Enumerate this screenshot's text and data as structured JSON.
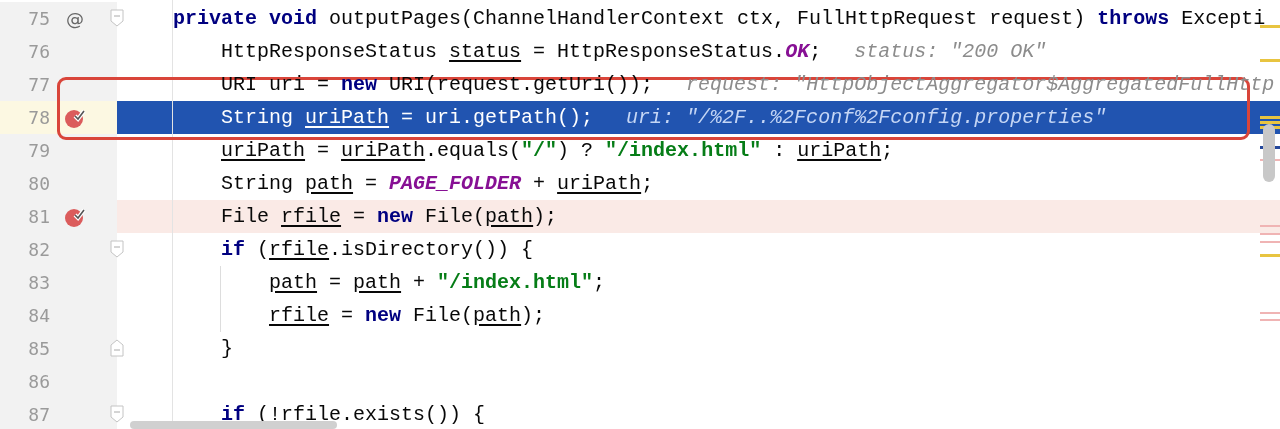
{
  "lines": [
    {
      "number": "75",
      "current": false,
      "gutter": {
        "kind": "implements",
        "glyph": "@"
      },
      "fold": {
        "kind": "start"
      },
      "tokens": [
        {
          "text": "private",
          "kind": "keyword"
        },
        {
          "text": " void",
          "kind": "keyword"
        },
        {
          "text": " outputPages(ChannelHandlerContext ctx, FullHttpRequest request) ",
          "kind": "plain"
        },
        {
          "text": "throws",
          "kind": "keyword"
        },
        {
          "text": " Excepti",
          "kind": "plain"
        }
      ]
    },
    {
      "number": "76",
      "current": false,
      "tokens": [
        {
          "text": "    HttpResponseStatus ",
          "kind": "plain"
        },
        {
          "text": "status",
          "kind": "var"
        },
        {
          "text": " = HttpResponseStatus.",
          "kind": "plain"
        },
        {
          "text": "OK",
          "kind": "constant"
        },
        {
          "text": ";",
          "kind": "plain"
        }
      ],
      "hint": "status: \"200 OK\""
    },
    {
      "number": "77",
      "current": false,
      "tokens": [
        {
          "text": "    URI uri = ",
          "kind": "plain"
        },
        {
          "text": "new",
          "kind": "keyword"
        },
        {
          "text": " URI(request.getUri());",
          "kind": "plain"
        }
      ],
      "hint": "request: \"HttpObjectAggregator$AggregatedFullHttp"
    },
    {
      "number": "78",
      "current": true,
      "gutter": {
        "kind": "breakpoint"
      },
      "tokens": [
        {
          "text": "    String ",
          "kind": "plain"
        },
        {
          "text": "uriPath",
          "kind": "var"
        },
        {
          "text": " = uri.getPath();",
          "kind": "plain"
        }
      ],
      "hint": "uri: \"/%2F..%2Fconf%2Fconfig.properties\""
    },
    {
      "number": "79",
      "current": false,
      "tokens": [
        {
          "text": "    uriPath",
          "kind": "var"
        },
        {
          "text": " = ",
          "kind": "plain"
        },
        {
          "text": "uriPath",
          "kind": "var"
        },
        {
          "text": ".equals(",
          "kind": "plain"
        },
        {
          "text": "\"/\"",
          "kind": "string"
        },
        {
          "text": ") ? ",
          "kind": "plain"
        },
        {
          "text": "\"/index.html\"",
          "kind": "string"
        },
        {
          "text": " : ",
          "kind": "plain"
        },
        {
          "text": "uriPath",
          "kind": "var"
        },
        {
          "text": ";",
          "kind": "plain"
        }
      ]
    },
    {
      "number": "80",
      "current": false,
      "tokens": [
        {
          "text": "    String ",
          "kind": "plain"
        },
        {
          "text": "path",
          "kind": "var"
        },
        {
          "text": " = ",
          "kind": "plain"
        },
        {
          "text": "PAGE_FOLDER",
          "kind": "constant"
        },
        {
          "text": " + ",
          "kind": "plain"
        },
        {
          "text": "uriPath",
          "kind": "var"
        },
        {
          "text": ";",
          "kind": "plain"
        }
      ]
    },
    {
      "number": "81",
      "current": false,
      "gutter": {
        "kind": "breakpoint"
      },
      "tokens": [
        {
          "text": "    File ",
          "kind": "plain"
        },
        {
          "text": "rfile",
          "kind": "var"
        },
        {
          "text": " = ",
          "kind": "plain"
        },
        {
          "text": "new",
          "kind": "keyword"
        },
        {
          "text": " File(",
          "kind": "plain"
        },
        {
          "text": "path",
          "kind": "var"
        },
        {
          "text": ");",
          "kind": "plain"
        }
      ]
    },
    {
      "number": "82",
      "current": false,
      "fold": {
        "kind": "start"
      },
      "tokens": [
        {
          "text": "    if",
          "kind": "keyword"
        },
        {
          "text": " (",
          "kind": "plain"
        },
        {
          "text": "rfile",
          "kind": "var"
        },
        {
          "text": ".isDirectory()) {",
          "kind": "plain"
        }
      ]
    },
    {
      "number": "83",
      "current": false,
      "tokens": [
        {
          "text": "        path",
          "kind": "var"
        },
        {
          "text": " = ",
          "kind": "plain"
        },
        {
          "text": "path",
          "kind": "var"
        },
        {
          "text": " + ",
          "kind": "plain"
        },
        {
          "text": "\"/index.html\"",
          "kind": "string"
        },
        {
          "text": ";",
          "kind": "plain"
        }
      ]
    },
    {
      "number": "84",
      "current": false,
      "tokens": [
        {
          "text": "        rfile",
          "kind": "var"
        },
        {
          "text": " = ",
          "kind": "plain"
        },
        {
          "text": "new",
          "kind": "keyword"
        },
        {
          "text": " File(",
          "kind": "plain"
        },
        {
          "text": "path",
          "kind": "var"
        },
        {
          "text": ");",
          "kind": "plain"
        }
      ]
    },
    {
      "number": "85",
      "current": false,
      "fold": {
        "kind": "end"
      },
      "tokens": [
        {
          "text": "    }",
          "kind": "plain"
        }
      ]
    },
    {
      "number": "86",
      "current": false
    },
    {
      "number": "87",
      "current": false,
      "fold": {
        "kind": "start"
      },
      "tokens": [
        {
          "text": "    if",
          "kind": "keyword"
        },
        {
          "text": " (!rfile.exists()) {",
          "kind": "plain"
        }
      ]
    }
  ]
}
